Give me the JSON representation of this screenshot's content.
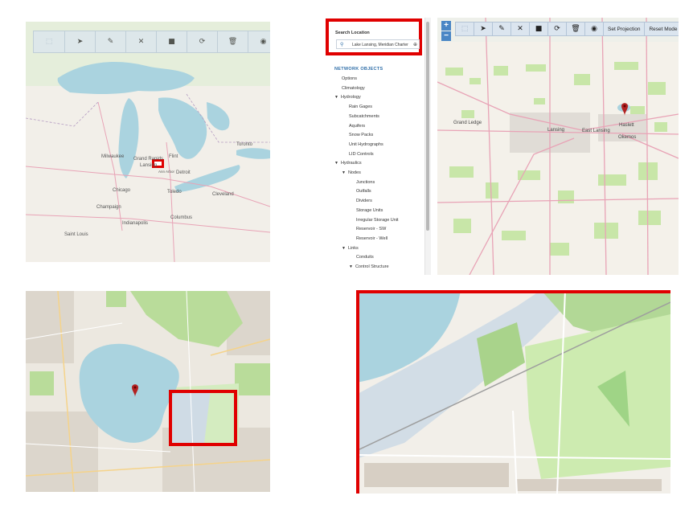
{
  "toolbar": {
    "select_label": "⬚",
    "pointer_label": "➤",
    "edit_label": "✎",
    "delete_label": "✕",
    "vehicle_label": "■",
    "refresh_label": "⟳",
    "trash_label": "🗑",
    "target_label": "◉",
    "set_projection_label": "Set Projection",
    "reset_model_label": "Reset Mode"
  },
  "zoom": {
    "in_label": "+",
    "out_label": "−"
  },
  "search": {
    "title": "Search Location",
    "value": "Lake Lansing, Meridian Charter"
  },
  "network": {
    "title": "NETWORK OBJECTS",
    "items": [
      {
        "label": "Options",
        "level": 0,
        "caret": ""
      },
      {
        "label": "Climatology",
        "level": 0,
        "caret": ""
      },
      {
        "label": "Hydrology",
        "level": 0,
        "caret": "▼"
      },
      {
        "label": "Rain Gages",
        "level": 1,
        "caret": ""
      },
      {
        "label": "Subcatchments",
        "level": 1,
        "caret": ""
      },
      {
        "label": "Aquifers",
        "level": 1,
        "caret": ""
      },
      {
        "label": "Snow Packs",
        "level": 1,
        "caret": ""
      },
      {
        "label": "Unit Hydrographs",
        "level": 1,
        "caret": ""
      },
      {
        "label": "LID Controls",
        "level": 1,
        "caret": ""
      },
      {
        "label": "Hydraulics",
        "level": 0,
        "caret": "▼"
      },
      {
        "label": "Nodes",
        "level": 1,
        "caret": "▼"
      },
      {
        "label": "Junctions",
        "level": 2,
        "caret": ""
      },
      {
        "label": "Outfalls",
        "level": 2,
        "caret": ""
      },
      {
        "label": "Dividers",
        "level": 2,
        "caret": ""
      },
      {
        "label": "Storage Units",
        "level": 2,
        "caret": ""
      },
      {
        "label": "Irregular Storage Unit",
        "level": 2,
        "caret": ""
      },
      {
        "label": "Reservoir - SW",
        "level": 2,
        "caret": ""
      },
      {
        "label": "Reservoir - Well",
        "level": 2,
        "caret": ""
      },
      {
        "label": "Links",
        "level": 1,
        "caret": "▼"
      },
      {
        "label": "Conduits",
        "level": 2,
        "caret": ""
      },
      {
        "label": "Control Structure",
        "level": 2,
        "caret": "▼"
      }
    ]
  },
  "map_labels": {
    "panel1": [
      "Milwaukee",
      "Chicago",
      "Detroit",
      "Toledo",
      "Cleveland",
      "Columbus",
      "Indianapolis",
      "Ann Arbor",
      "Champaign",
      "Saint Louis",
      "Grand Rapids",
      "Lansing",
      "Flint",
      "Toronto"
    ],
    "panel2": [
      "Lansing",
      "East Lansing",
      "Grand Ledge",
      "Okemos",
      "Haslett"
    ]
  },
  "colors": {
    "highlight": "#e00000",
    "water": "#aad3df",
    "land": "#f2efe9",
    "park": "#c8e6a8",
    "wetland": "#d2dde6",
    "road": "#e8a3b6",
    "toolbar_blue": "#4a86c5"
  }
}
